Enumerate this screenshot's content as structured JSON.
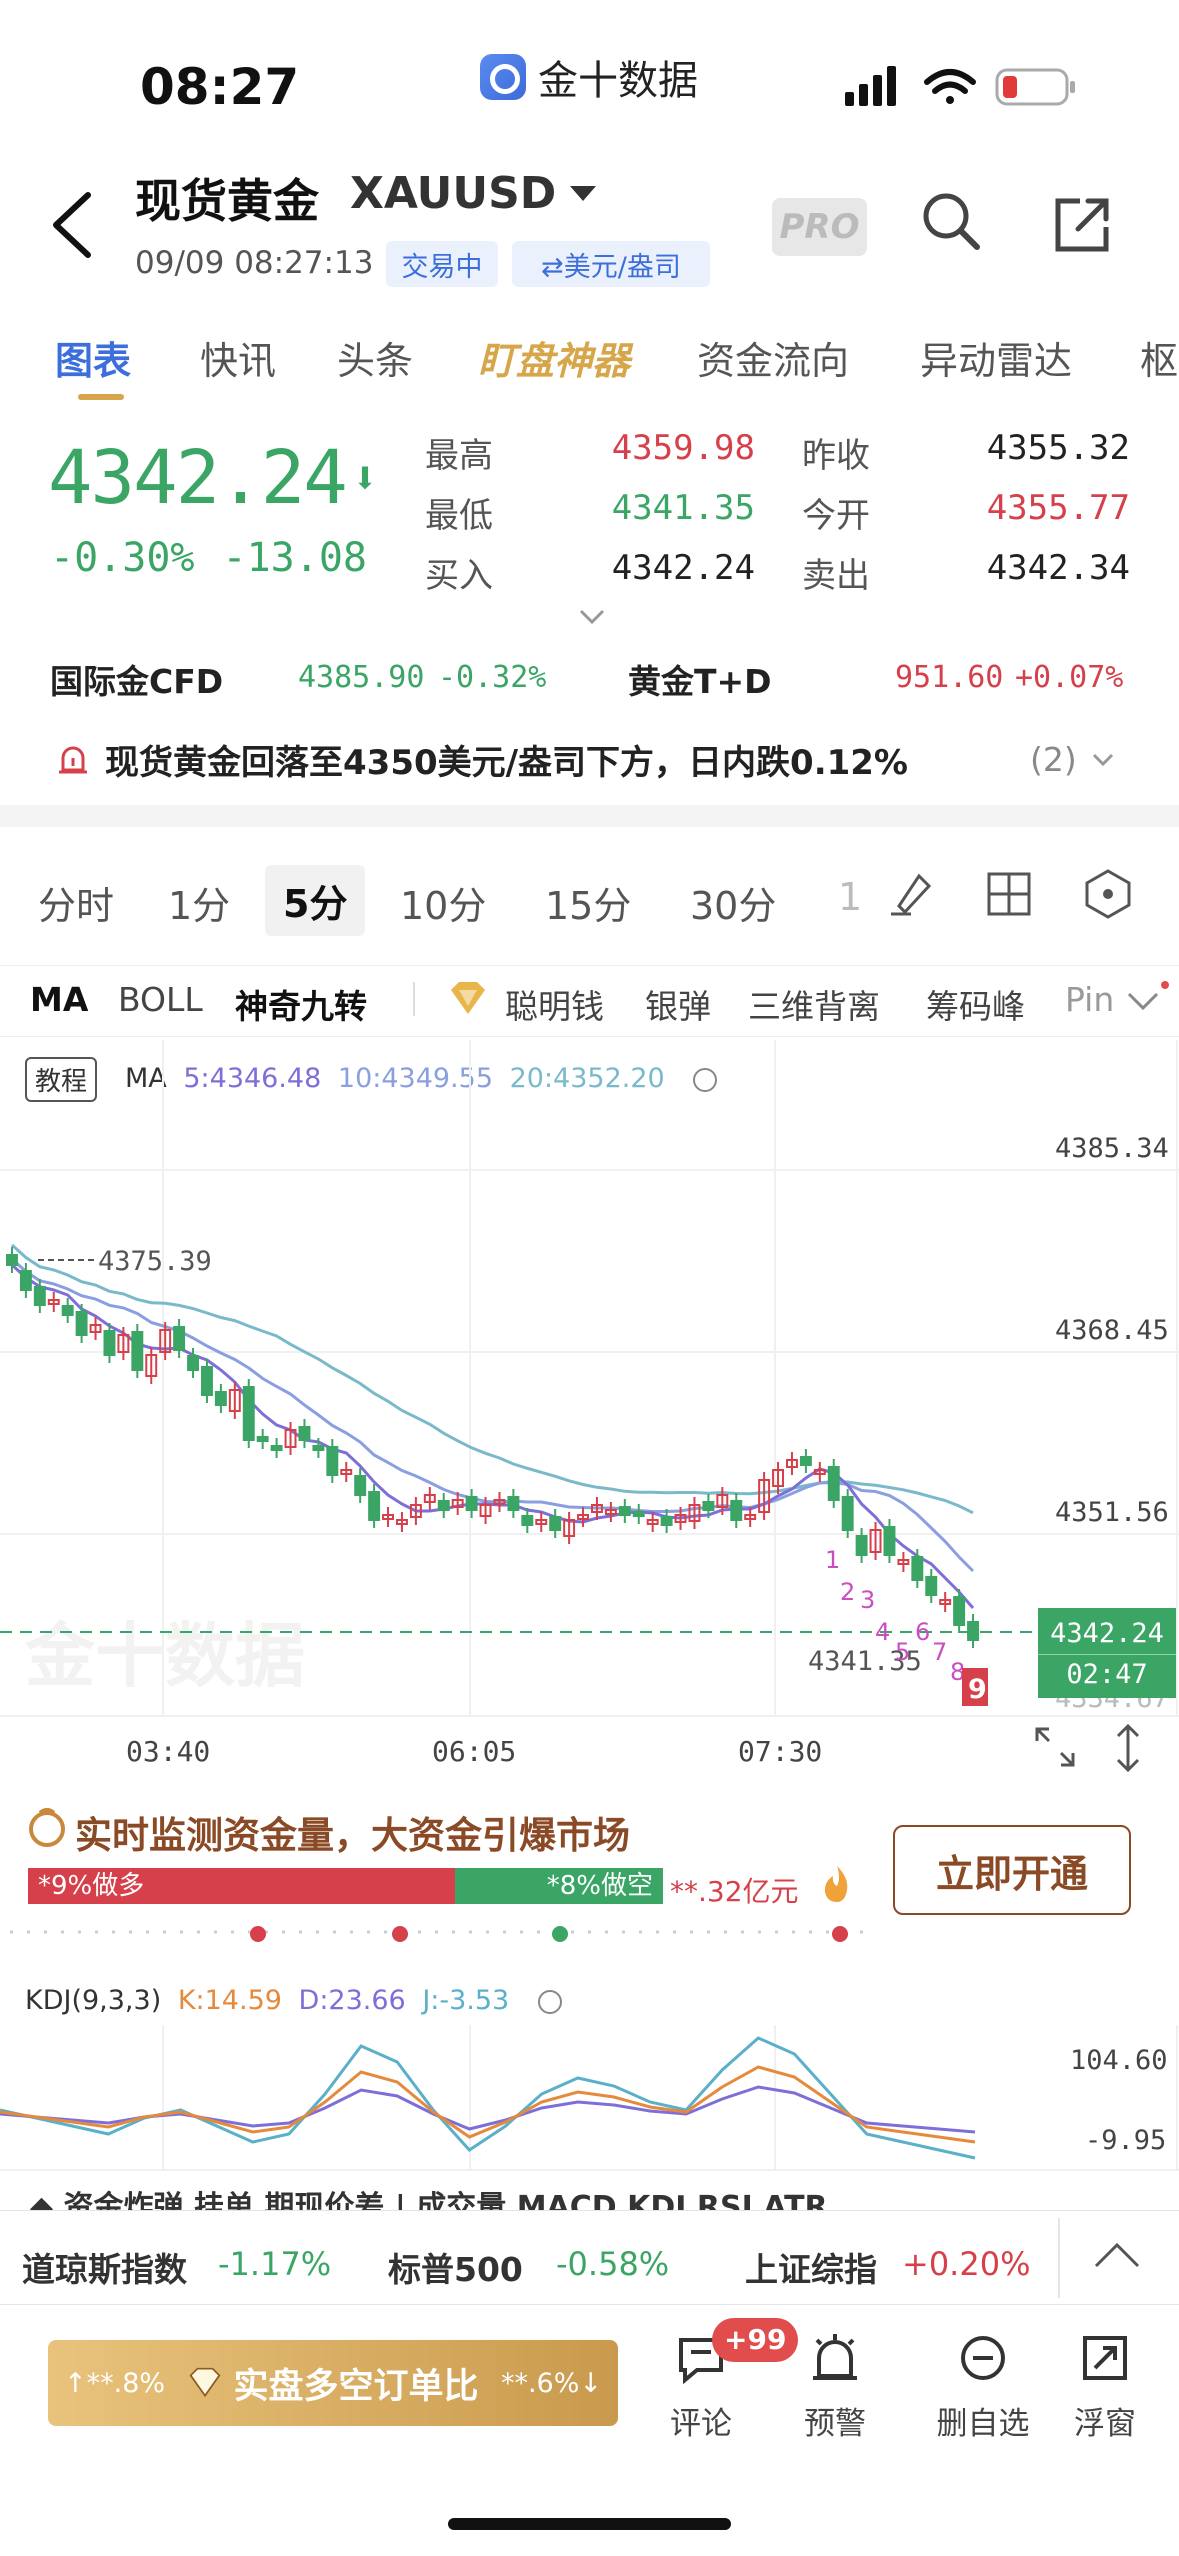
{
  "status_bar": {
    "time": "08:27",
    "app_name": "金十数据"
  },
  "header": {
    "title": "现货黄金",
    "symbol": "XAUUSD",
    "datetime": "09/09 08:27:13",
    "trading_status": "交易中",
    "unit": "⇄美元/盎司",
    "pro": "PRO"
  },
  "tabs": [
    "图表",
    "快讯",
    "头条",
    "盯盘神器",
    "资金流向",
    "异动雷达",
    "枢"
  ],
  "quote": {
    "price": "4342.24",
    "change_pct": "-0.30%",
    "change": "-13.08",
    "high_label": "最高",
    "high": "4359.98",
    "low_label": "最低",
    "low": "4341.35",
    "bid_label": "买入",
    "bid": "4342.24",
    "prev_close_label": "昨收",
    "prev_close": "4355.32",
    "open_label": "今开",
    "open": "4355.77",
    "ask_label": "卖出",
    "ask": "4342.34"
  },
  "related": [
    {
      "name": "国际金CFD",
      "price": "4385.90",
      "change": "-0.32%"
    },
    {
      "name": "黄金T+D",
      "price": "951.60",
      "change": "+0.07%"
    }
  ],
  "alert": {
    "text": "现货黄金回落至4350美元/盎司下方，日内跌0.12%",
    "count": "(2)"
  },
  "periods": [
    "分时",
    "1分",
    "5分",
    "10分",
    "15分",
    "30分",
    "1"
  ],
  "indicators": [
    "MA",
    "BOLL",
    "神奇九转",
    "聪明钱",
    "银弹",
    "三维背离",
    "筹码峰",
    "Pin"
  ],
  "chart": {
    "tutorial": "教程",
    "ma_label": "MA",
    "ma5": "5:4346.48",
    "ma10": "10:4349.55",
    "ma20": "20:4352.20",
    "yticks": [
      "4385.34",
      "4368.45",
      "4351.56"
    ],
    "last_price": "4342.24",
    "countdown": "02:47",
    "bottom_partial": "4334.67",
    "high_marker": "4375.39",
    "low_marker": "4341.35",
    "xticks": [
      "03:40",
      "06:05",
      "07:30"
    ],
    "nine_turn": [
      "1",
      "2",
      "3",
      "4",
      "5",
      "6",
      "7",
      "8",
      "9"
    ],
    "watermark": "金十数据",
    "colors": {
      "up": "#d6404a",
      "down": "#3aa565",
      "ma5": "#7e6fd8",
      "ma10": "#8a9fe0",
      "ma20": "#7ab9c9"
    }
  },
  "monitor": {
    "title": "实时监测资金量，大资金引爆市场",
    "long": "*9%做多",
    "short": "*8%做空",
    "amount": "**.32亿元",
    "button": "立即开通"
  },
  "kdj": {
    "label": "KDJ(9,3,3)",
    "k": "K:14.59",
    "d": "D:23.66",
    "j": "J:-3.53",
    "top": "104.60",
    "bottom": "-9.95"
  },
  "indices": [
    {
      "name": "道琼斯指数",
      "change": "-1.17%"
    },
    {
      "name": "标普500",
      "change": "-0.58%"
    },
    {
      "name": "上证综指",
      "change": "+0.20%"
    }
  ],
  "bottom": {
    "ls_left": "↑**.8%",
    "ls_title": "实盘多空订单比",
    "ls_right": "**.6%↓",
    "badge": "+99",
    "actions": [
      "评论",
      "预警",
      "删自选",
      "浮窗"
    ]
  }
}
